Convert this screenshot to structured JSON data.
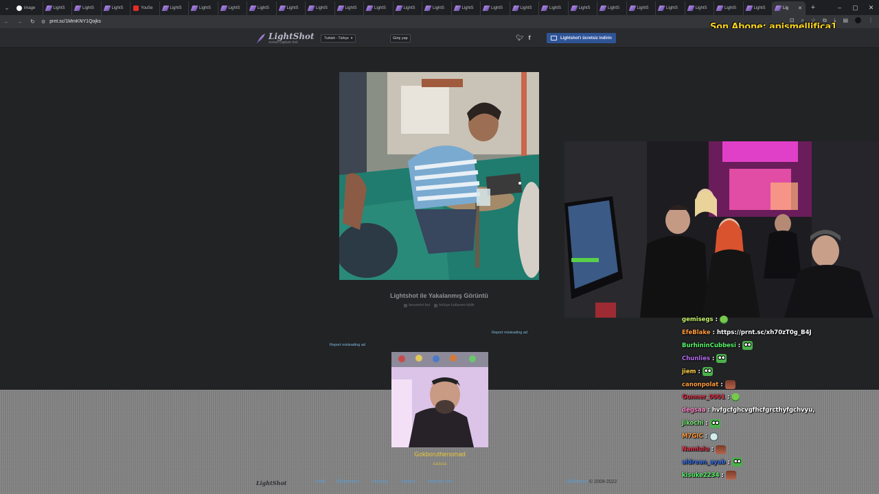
{
  "browser": {
    "tabs": [
      {
        "label": "image",
        "icon": "google-icon"
      },
      {
        "label": "LightS",
        "icon": "lightshot-icon"
      },
      {
        "label": "LightS",
        "icon": "lightshot-icon"
      },
      {
        "label": "LightS",
        "icon": "lightshot-icon"
      },
      {
        "label": "YouSe",
        "icon": "youtube-icon"
      },
      {
        "label": "LightS",
        "icon": "lightshot-icon"
      },
      {
        "label": "LightS",
        "icon": "lightshot-icon"
      },
      {
        "label": "LightS",
        "icon": "lightshot-icon"
      },
      {
        "label": "LightS",
        "icon": "lightshot-icon"
      },
      {
        "label": "LightS",
        "icon": "lightshot-icon"
      },
      {
        "label": "LightS",
        "icon": "lightshot-icon"
      },
      {
        "label": "LightS",
        "icon": "lightshot-icon"
      },
      {
        "label": "LightS",
        "icon": "lightshot-icon"
      },
      {
        "label": "LightS",
        "icon": "lightshot-icon"
      },
      {
        "label": "LightS",
        "icon": "lightshot-icon"
      },
      {
        "label": "LightS",
        "icon": "lightshot-icon"
      },
      {
        "label": "LightS",
        "icon": "lightshot-icon"
      },
      {
        "label": "LightS",
        "icon": "lightshot-icon"
      },
      {
        "label": "LightS",
        "icon": "lightshot-icon"
      },
      {
        "label": "LightS",
        "icon": "lightshot-icon"
      },
      {
        "label": "LightS",
        "icon": "lightshot-icon"
      },
      {
        "label": "LightS",
        "icon": "lightshot-icon"
      },
      {
        "label": "LightS",
        "icon": "lightshot-icon"
      },
      {
        "label": "LightS",
        "icon": "lightshot-icon"
      },
      {
        "label": "LightS",
        "icon": "lightshot-icon"
      },
      {
        "label": "LightS",
        "icon": "lightshot-icon"
      }
    ],
    "active_tab": {
      "label": "Lig",
      "icon": "lightshot-icon"
    },
    "new_tab": "+",
    "url": "prnt.sc/1MmKNY1Qojks",
    "window_controls": [
      "–",
      "▢",
      "✕"
    ]
  },
  "stream_overlay": {
    "last_subscriber": "Son Abone: apismellifica1",
    "streamer_name": "Gokboruthenomad",
    "streamer_sub": "AAAAA"
  },
  "lightshot": {
    "logo_name": "LightShot",
    "logo_sub": "screen capture tool",
    "language": "Turkish - Türkçe",
    "login": "Giriş yap",
    "download": "Lightshot'ı ücretsiz indirin",
    "caption_title": "Lightshot ile Yakalanmış Görüntü",
    "find_similar": "benzerini bul",
    "report_abuse": "kötüye kullanım bildir",
    "report_ad": "Report misleading ad",
    "footer": {
      "logo": "LightShot",
      "links": [
        "İndir",
        "Öğretenler",
        "Privacy",
        "Yardım",
        "Reklam Ver"
      ],
      "copyright_brand": "Skillbrains",
      "copyright_years": "© 2009-2022"
    }
  },
  "chat": [
    {
      "user": "gemisegs",
      "color": "#c6f26b",
      "text": "",
      "emote": "em-pepe"
    },
    {
      "user": "EfeBlake",
      "color": "#ff9b3d",
      "text": "https://prnt.sc/xh70zT0g_B4J",
      "emote": ""
    },
    {
      "user": "BurhininCubbesi",
      "color": "#59f36a",
      "text": "",
      "emote": "em-frog"
    },
    {
      "user": "Chunlies",
      "color": "#b66cf2",
      "text": "",
      "emote": "em-frog"
    },
    {
      "user": "jiem",
      "color": "#ffd24a",
      "text": "",
      "emote": "em-frog"
    },
    {
      "user": "canonpolat",
      "color": "#ff9b3d",
      "text": "",
      "emote": "em-face"
    },
    {
      "user": "Gunner_0001",
      "color": "#e0324a",
      "text": "",
      "emote": "em-pepe"
    },
    {
      "user": "degsaa",
      "color": "#ff89c9",
      "text": "hvfgcfghcvgfhcfgrcthyfgchvyu,",
      "emote": ""
    },
    {
      "user": "Jikochi",
      "color": "#7ae87a",
      "text": "",
      "emote": "em-frog"
    },
    {
      "user": "M7GIC",
      "color": "#ff9b3d",
      "text": "",
      "emote": "em-skull"
    },
    {
      "user": "Namlulu",
      "color": "#e0324a",
      "text": "",
      "emote": "em-face"
    },
    {
      "user": "aldrean_ayab",
      "color": "#3b6ee0",
      "text": "",
      "emote": "em-frog"
    },
    {
      "user": "kisuke2234",
      "color": "#59f36a",
      "text": "",
      "emote": "em-face"
    }
  ]
}
